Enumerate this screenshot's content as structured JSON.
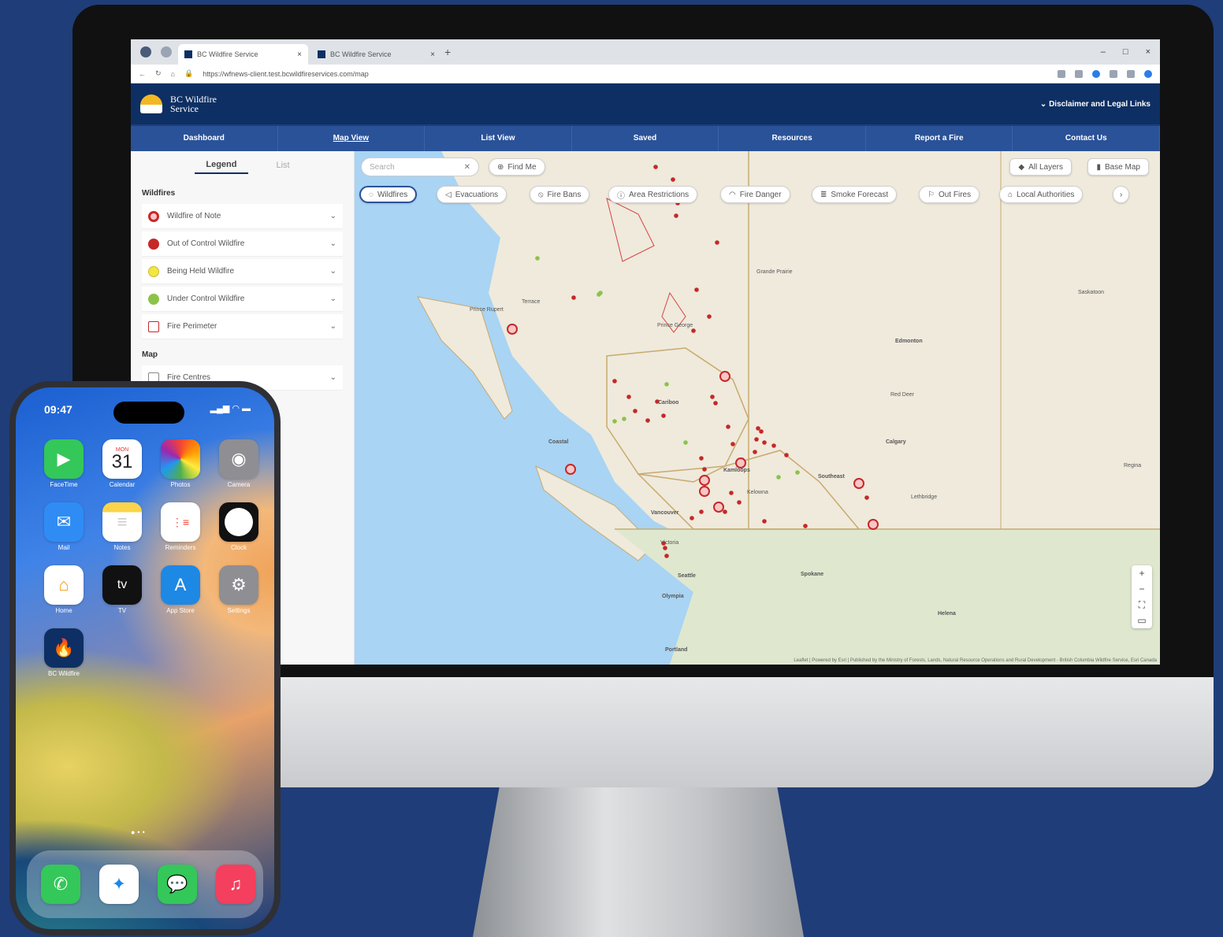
{
  "browser": {
    "tabs": [
      "BC Wildfire Service",
      "BC Wildfire Service"
    ],
    "url": "https://wfnews-client.test.bcwildfireservices.com/map"
  },
  "site": {
    "logo_line1": "BC Wildfire",
    "logo_line2": "Service",
    "disclaimer": "Disclaimer and Legal Links",
    "nav": [
      "Dashboard",
      "Map View",
      "List View",
      "Saved",
      "Resources",
      "Report a Fire",
      "Contact Us"
    ]
  },
  "legend": {
    "tabs": [
      "Legend",
      "List"
    ],
    "wildfires_title": "Wildfires",
    "items": [
      {
        "label": "Wildfire of Note",
        "color": "#c62828"
      },
      {
        "label": "Out of Control Wildfire",
        "color": "#c62828"
      },
      {
        "label": "Being Held Wildfire",
        "color": "#f4e542"
      },
      {
        "label": "Under Control Wildfire",
        "color": "#8bc34a"
      },
      {
        "label": "Fire Perimeter",
        "color": "#ffffff"
      }
    ],
    "map_title": "Map",
    "map_item": "Fire Centres"
  },
  "map": {
    "search_placeholder": "Search",
    "find_me": "Find Me",
    "all_layers": "All Layers",
    "base_map": "Base Map",
    "chips": [
      "Wildfires",
      "Evacuations",
      "Fire Bans",
      "Area Restrictions",
      "Fire Danger",
      "Smoke Forecast",
      "Out Fires",
      "Local Authorities"
    ],
    "places": {
      "prince_rupert": "Prince Rupert",
      "terrace": "Terrace",
      "prince_george": "Prince George",
      "cariboo": "Cariboo",
      "coastal": "Coastal",
      "kamloops": "Kamloops",
      "kelowna": "Kelowna",
      "vancouver": "Vancouver",
      "victoria": "Victoria",
      "seattle": "Seattle",
      "olympia": "Olympia",
      "portland": "Portland",
      "edmonton": "Edmonton",
      "calgary": "Calgary",
      "red_deer": "Red Deer",
      "lethbridge": "Lethbridge",
      "spokane": "Spokane",
      "helena": "Helena",
      "southeast": "Southeast",
      "grande_prairie": "Grande Prairie",
      "regina": "Regina",
      "saskatoon": "Saskatoon"
    },
    "attribution": "Leaflet | Powered by Esri | Published by the Ministry of Forests, Lands, Natural Resource Operations and Rural Development - British Columbia Wildfire Service, Esri Canada"
  },
  "phone": {
    "time": "09:47",
    "calendar_day": "MON",
    "calendar_date": "31",
    "apps": [
      "FaceTime",
      "Calendar",
      "Photos",
      "Camera",
      "Mail",
      "Notes",
      "Reminders",
      "Clock",
      "Home",
      "TV",
      "App Store",
      "Settings",
      "BC Wildfire"
    ]
  }
}
